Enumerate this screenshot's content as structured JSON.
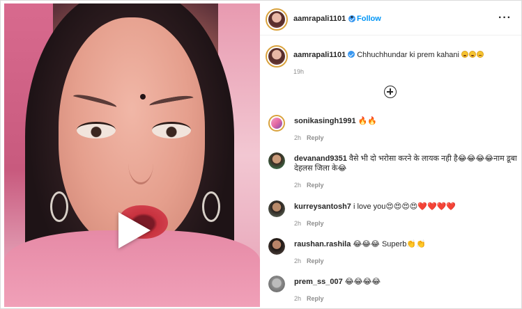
{
  "post": {
    "username": "aamrapali1101",
    "follow_label": "Follow",
    "separator": "•",
    "more_icon": "more-horizontal-icon",
    "more_label": "···",
    "caption_text": "Chhuchhundar ki prem kahani",
    "caption_emojis": [
      "laugh-icon",
      "laugh-icon",
      "sad-icon"
    ],
    "caption_time": "19h",
    "add_comment_icon": "plus-circle-icon",
    "verified_color": "#3897f0",
    "follow_color": "#0095f6"
  },
  "comments": [
    {
      "username": "sonikasingh1991",
      "text": "🔥🔥",
      "time": "2h",
      "reply": "Reply"
    },
    {
      "username": "devanand9351",
      "text": "वैसे भी दो भरोसा करने के लायक नही है😂😂😂😂नाम डूबा देहलस जिला के😂",
      "time": "2h",
      "reply": "Reply"
    },
    {
      "username": "kurreysantosh7",
      "text": "i love you😍😍😍😍❤️❤️❤️❤️",
      "time": "2h",
      "reply": "Reply"
    },
    {
      "username": "raushan.rashila",
      "text": "😂😂😂 Superb👏👏",
      "time": "2h",
      "reply": "Reply"
    },
    {
      "username": "prem_ss_007",
      "text": "😂😂😂😂",
      "time": "2h",
      "reply": "Reply"
    }
  ]
}
